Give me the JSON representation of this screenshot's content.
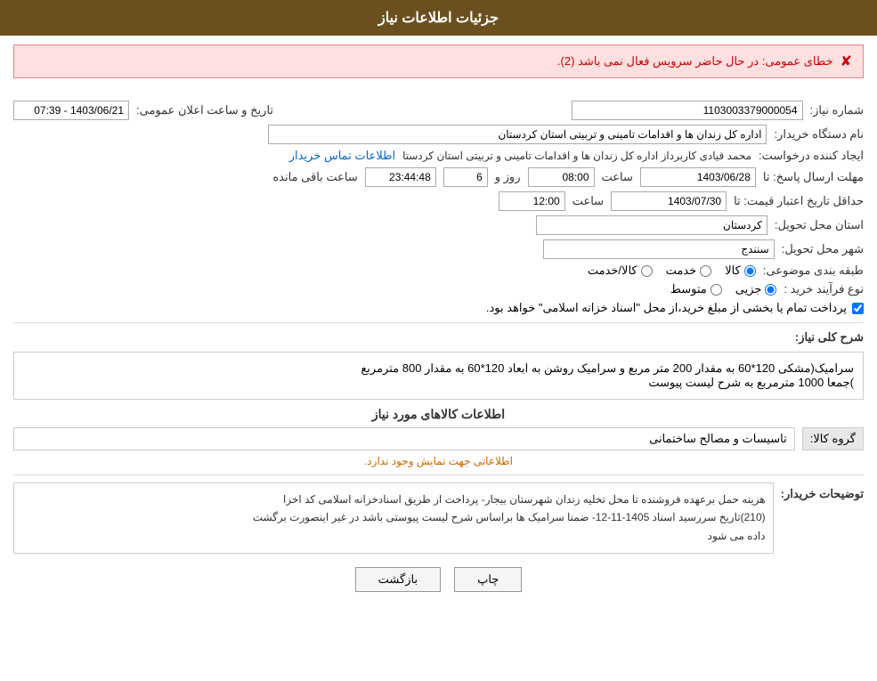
{
  "header": {
    "title": "جزئیات اطلاعات نیاز"
  },
  "error": {
    "message": "خطای عمومی: در حال حاضر سرویس فعال نمی باشد (2)."
  },
  "form": {
    "shomareNiaz_label": "شماره نیاز:",
    "shomareNiaz_value": "1103003379000054",
    "namdastgah_label": "نام دستگاه خریدار:",
    "namdastgah_value": "اداره کل زندان ها و اقدامات تامینی و تربیتی استان کردستان",
    "ijadkonande_label": "ایجاد کننده درخواست:",
    "ijadkonande_value": "محمد  قیادی کاربرداز اداره کل زندان ها و اقدامات تامینی و تربیتی استان کردستا",
    "ijadkonande_link": "اطلاعات تماس خریدار",
    "tarikhIelan_label": "تاریخ و ساعت اعلان عمومی:",
    "tarikhIelan_value": "1403/06/21 - 07:39",
    "mohlat_label": "مهلت ارسال پاسخ: تا",
    "mohlat_date": "1403/06/28",
    "mohlat_time": "08:00",
    "mohlat_roz": "6",
    "mohlat_countdown": "23:44:48",
    "mohlat_unit": "ساعت باقی مانده",
    "hadaqal_label": "حداقل تاریخ اعتبار قیمت: تا",
    "hadaqal_date": "1403/07/30",
    "hadaqal_time": "12:00",
    "ostan_label": "استان محل تحویل:",
    "ostan_value": "کردستان",
    "shahr_label": "شهر محل تحویل:",
    "shahr_value": "سنندج",
    "tabaqe_label": "طبقه بندی موضوعی:",
    "tabaqe_options": [
      "کالا",
      "خدمت",
      "کالا/خدمت"
    ],
    "tabaqe_selected": "کالا",
    "noeFarayand_label": "نوع فرآیند خرید :",
    "noeFarayand_options": [
      "جزیی",
      "متوسط"
    ],
    "noeFarayand_selected": "جزیی",
    "pardakht_label": "پرداخت تمام یا بخشی از مبلغ خرید،از محل \"اسناد خزانه اسلامی\" خواهد بود.",
    "pardakht_checked": true,
    "sharhKoli_label": "شرح کلی نیاز:",
    "sharhKoli_text_line1": "سرامیک(مشکی  120*60  به مقدار 200 متر مربع  و  سرامیک روشن به ابعاد 120*60 به مقدار 800 مترمربع",
    "sharhKoli_text_line2": ")جمعا 1000 مترمربع به شرح لیست پیوست",
    "kalaInfo_title": "اطلاعات کالاهای مورد نیاز",
    "groupKala_label": "گروه کالا:",
    "groupKala_value": "تاسیسات و مصالح ساختمانی",
    "noInfo_text": "اطلاعاتی جهت نمایش وجود ندارد.",
    "description_label": "توضیحات خریدار:",
    "description_text_line1": "هزینه حمل برعهده فروشنده  تا محل  تخلیه  زندان  شهرستان بیجار- پرداخت از طریق اسنادخزانه اسلامی کد اخزا",
    "description_text_line2": "(210)تاریخ سررسید اسناد 1405-11-12- ضمنا سرامیک ها براساس شرح لیست پیوستی باشد در غیر اینصورت برگشت",
    "description_text_line3": "داده می شود",
    "btn_print": "چاپ",
    "btn_back": "بازگشت"
  }
}
